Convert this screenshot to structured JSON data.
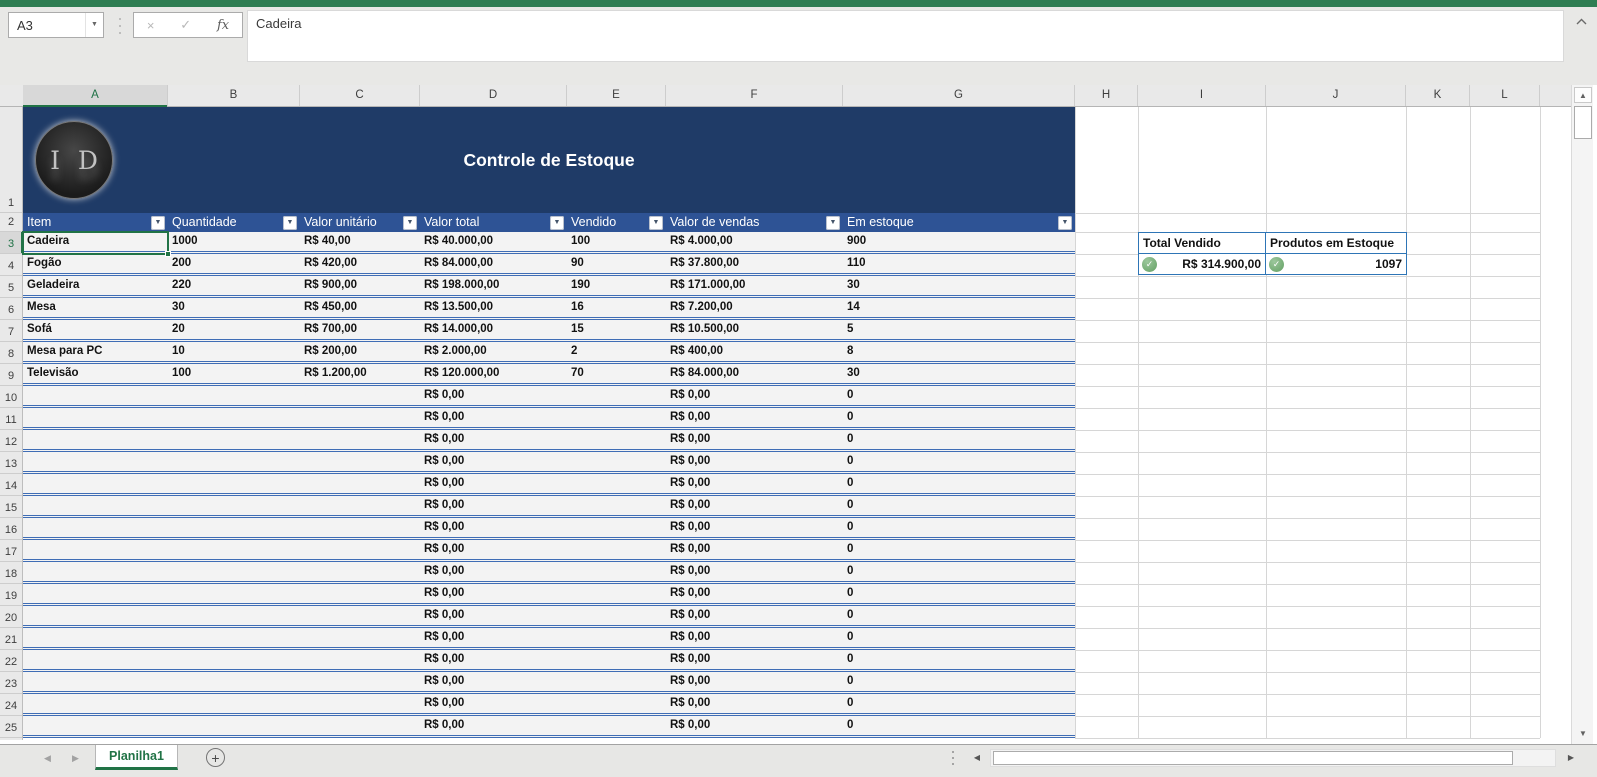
{
  "app": {
    "name_box": "A3",
    "formula_bar_value": "Cadeira"
  },
  "columns": [
    "A",
    "B",
    "C",
    "D",
    "E",
    "F",
    "G",
    "H",
    "I",
    "J",
    "K",
    "L"
  ],
  "row_numbers": [
    "1",
    "2",
    "3",
    "4",
    "5",
    "6",
    "7",
    "8",
    "9",
    "10",
    "11",
    "12",
    "13",
    "14",
    "15",
    "16",
    "17",
    "18",
    "19",
    "20",
    "21",
    "22",
    "23",
    "24",
    "25"
  ],
  "banner": {
    "title": "Controle de Estoque",
    "logo_text": "I D"
  },
  "table": {
    "headers": [
      "Item",
      "Quantidade",
      "Valor unitário",
      "Valor total",
      "Vendido",
      "Valor  de vendas",
      "Em estoque"
    ],
    "data_rows": [
      [
        "Cadeira",
        "1000",
        "R$ 40,00",
        "R$ 40.000,00",
        "100",
        "R$ 4.000,00",
        "900"
      ],
      [
        "Fogão",
        "200",
        "R$ 420,00",
        "R$ 84.000,00",
        "90",
        "R$ 37.800,00",
        "110"
      ],
      [
        "Geladeira",
        "220",
        "R$ 900,00",
        "R$ 198.000,00",
        "190",
        "R$ 171.000,00",
        "30"
      ],
      [
        "Mesa",
        "30",
        "R$ 450,00",
        "R$ 13.500,00",
        "16",
        "R$ 7.200,00",
        "14"
      ],
      [
        "Sofá",
        "20",
        "R$ 700,00",
        "R$ 14.000,00",
        "15",
        "R$ 10.500,00",
        "5"
      ],
      [
        "Mesa para PC",
        "10",
        "R$ 200,00",
        "R$ 2.000,00",
        "2",
        "R$ 400,00",
        "8"
      ],
      [
        "Televisão",
        "100",
        "R$ 1.200,00",
        "R$ 120.000,00",
        "70",
        "R$ 84.000,00",
        "30"
      ]
    ],
    "empty_row": [
      "",
      "",
      "",
      "R$ 0,00",
      "",
      "R$ 0,00",
      "0"
    ],
    "empty_row_count": 16
  },
  "summary": {
    "col1_header": "Total Vendido",
    "col2_header": "Produtos em Estoque",
    "col1_value": "R$ 314.900,00",
    "col2_value": "1097"
  },
  "sheet_tabs": {
    "active_tab": "Planilha1"
  },
  "icons": {
    "name_box_dropdown": "▼",
    "cancel": "×",
    "confirm": "✓",
    "function": "fx",
    "filter_dropdown": "▼",
    "scroll_up": "▲",
    "scroll_down": "▼",
    "scroll_left": "◀",
    "scroll_right": "▶",
    "tab_prev": "◀",
    "tab_next": "▶",
    "check": "✓",
    "add_sheet": "+"
  },
  "colors": {
    "excel_green": "#2e7d52",
    "tab_green": "#217346",
    "banner_blue": "#1f3b67",
    "header_blue": "#2e5395",
    "row_border_blue": "#3f6db5",
    "summary_border_blue": "#2e75b6",
    "check_green": "#63a063"
  }
}
